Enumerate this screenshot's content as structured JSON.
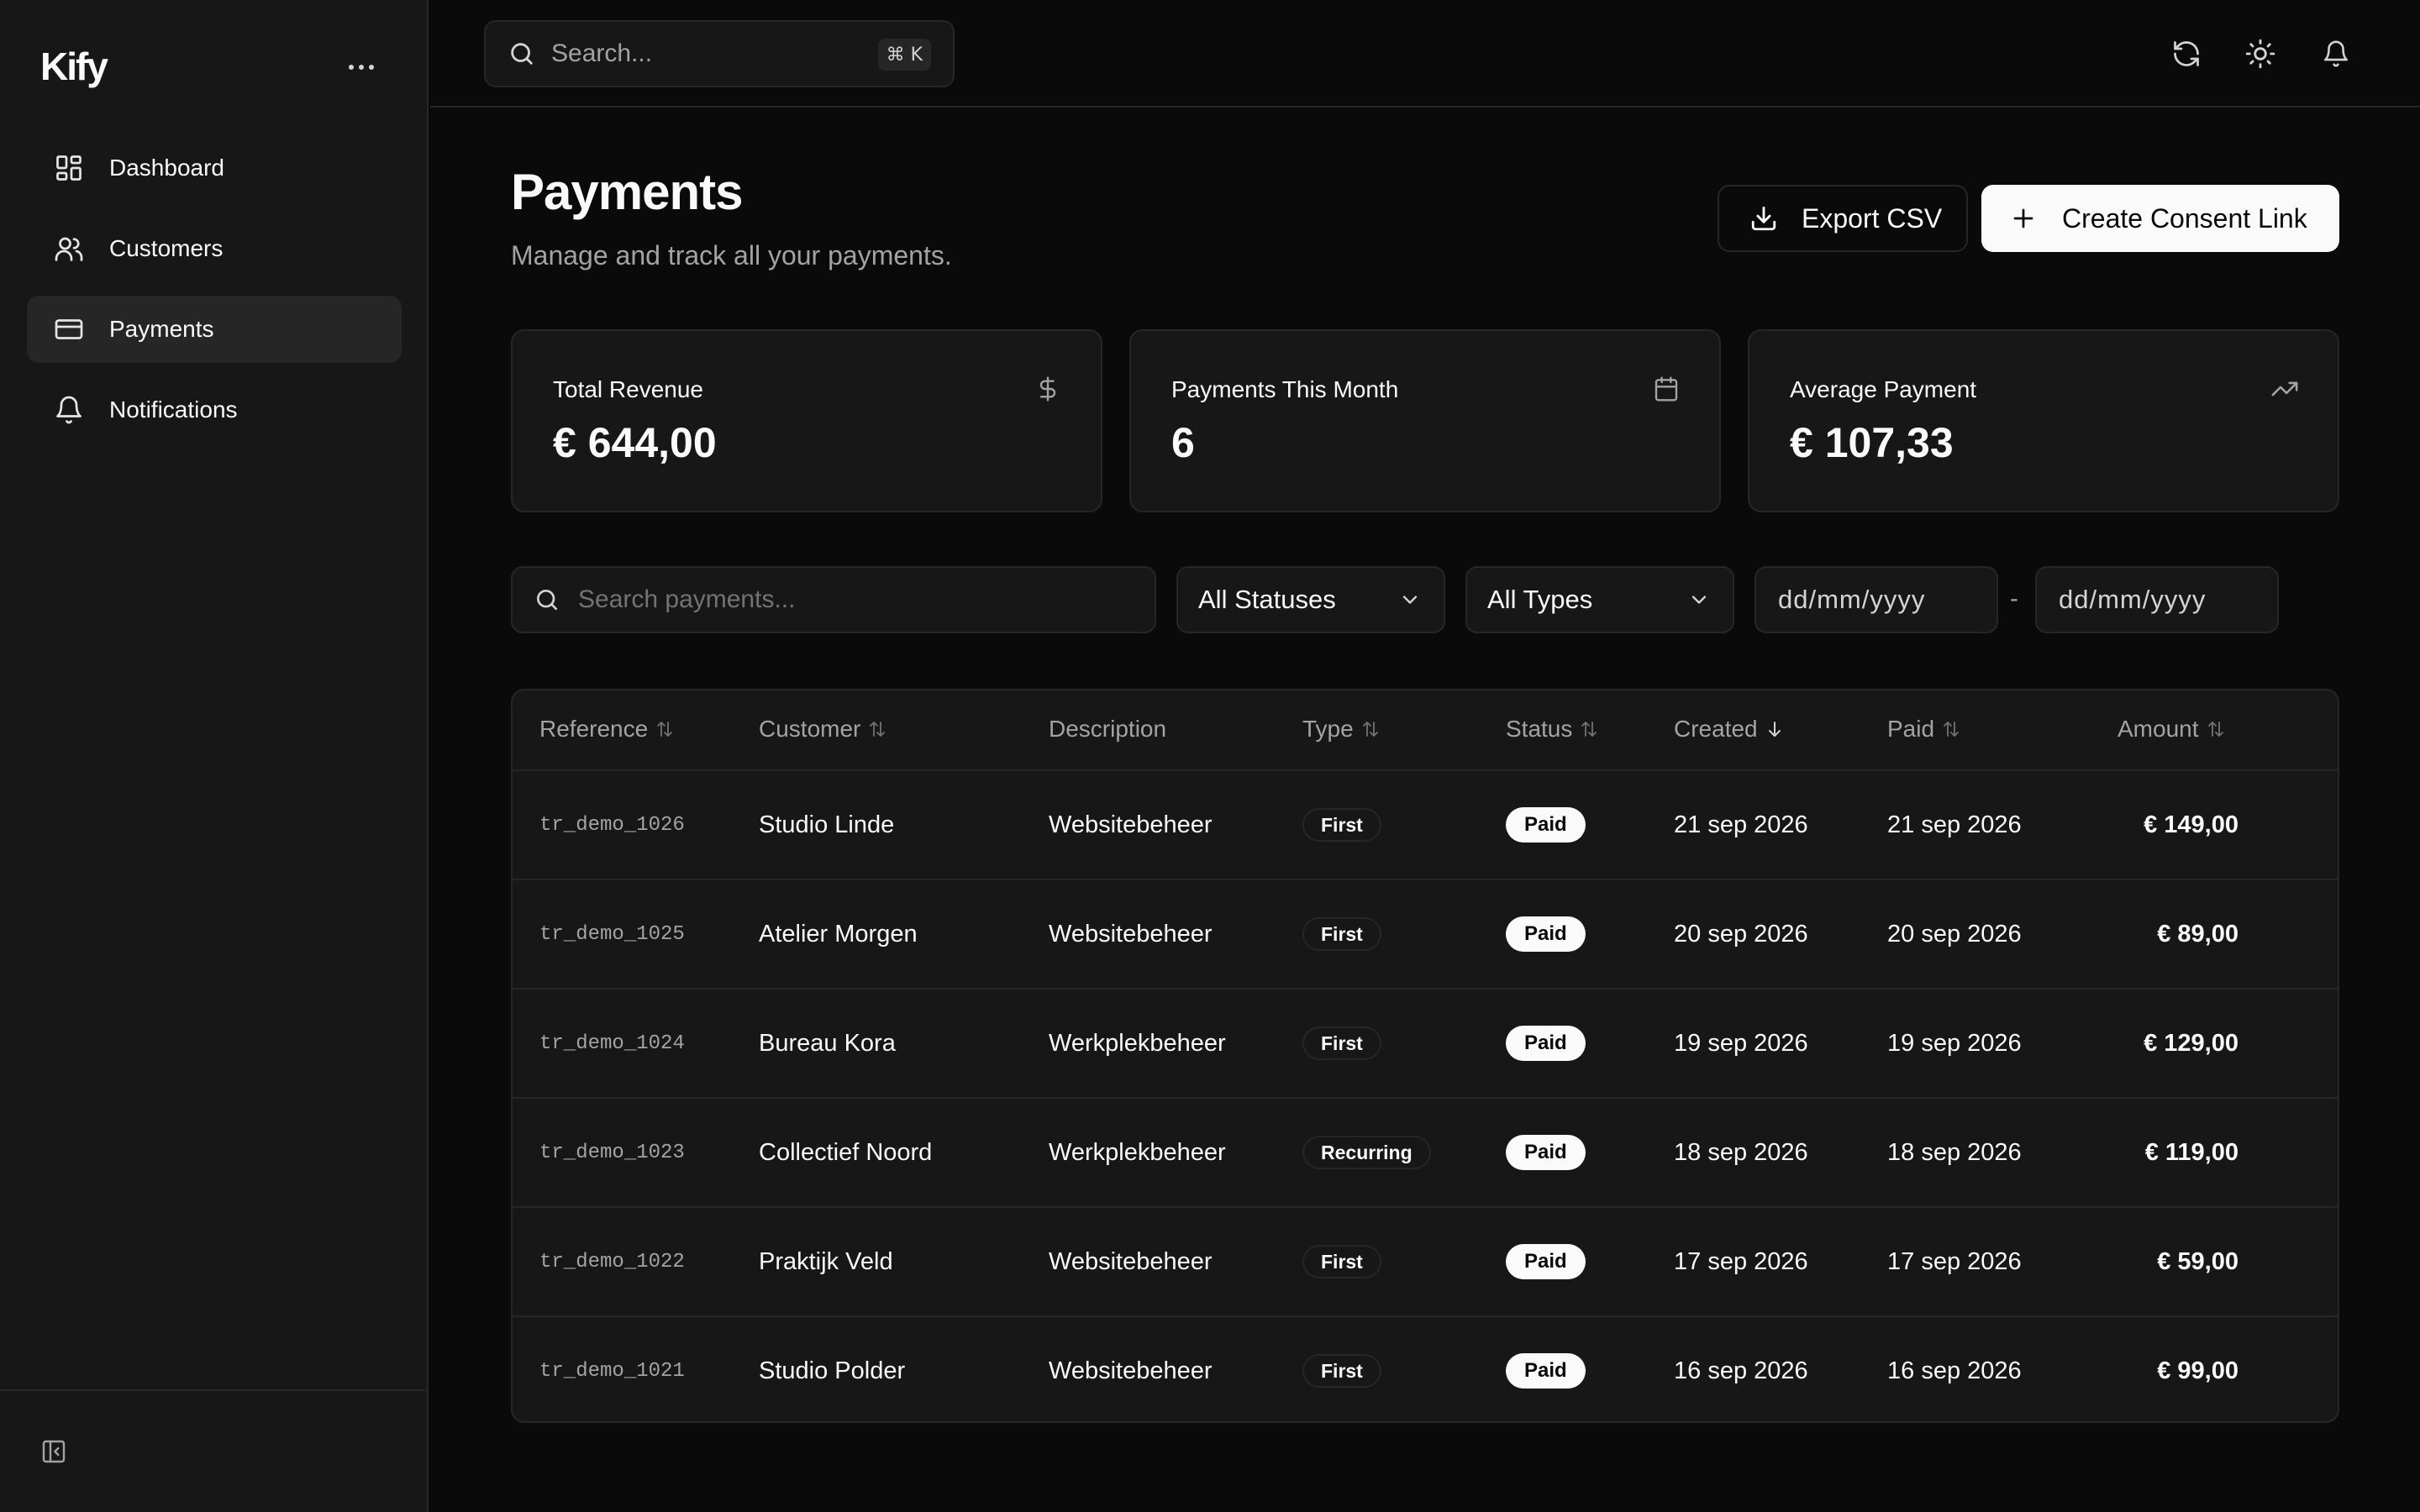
{
  "app": {
    "brand": "Kify"
  },
  "sidebar": {
    "items": [
      {
        "label": "Dashboard",
        "icon": "dashboard-icon",
        "active": false
      },
      {
        "label": "Customers",
        "icon": "users-icon",
        "active": false
      },
      {
        "label": "Payments",
        "icon": "credit-card-icon",
        "active": true
      },
      {
        "label": "Notifications",
        "icon": "bell-icon",
        "active": false
      }
    ]
  },
  "header": {
    "search_placeholder": "Search...",
    "shortcut_cmd": "⌘",
    "shortcut_key": "K"
  },
  "page": {
    "title": "Payments",
    "subtitle": "Manage and track all your payments.",
    "export_label": "Export CSV",
    "create_label": "Create Consent Link"
  },
  "stats": [
    {
      "title": "Total Revenue",
      "value": "€ 644,00",
      "icon": "dollar-icon"
    },
    {
      "title": "Payments This Month",
      "value": "6",
      "icon": "calendar-icon"
    },
    {
      "title": "Average Payment",
      "value": "€ 107,33",
      "icon": "trending-up-icon"
    }
  ],
  "filters": {
    "search_placeholder": "Search payments...",
    "status": "All Statuses",
    "type": "All Types",
    "date_from": "dd/mm/yyyy",
    "date_sep": "-",
    "date_to": "dd/mm/yyyy"
  },
  "table": {
    "columns": {
      "reference": "Reference",
      "customer": "Customer",
      "description": "Description",
      "type": "Type",
      "status": "Status",
      "created": "Created",
      "paid": "Paid",
      "amount": "Amount"
    },
    "rows": [
      {
        "reference": "tr_demo_1026",
        "customer": "Studio Linde",
        "description": "Websitebeheer",
        "type": "First",
        "status": "Paid",
        "created": "21 sep 2026",
        "paid": "21 sep 2026",
        "amount": "€ 149,00"
      },
      {
        "reference": "tr_demo_1025",
        "customer": "Atelier Morgen",
        "description": "Websitebeheer",
        "type": "First",
        "status": "Paid",
        "created": "20 sep 2026",
        "paid": "20 sep 2026",
        "amount": "€ 89,00"
      },
      {
        "reference": "tr_demo_1024",
        "customer": "Bureau Kora",
        "description": "Werkplekbeheer",
        "type": "First",
        "status": "Paid",
        "created": "19 sep 2026",
        "paid": "19 sep 2026",
        "amount": "€ 129,00"
      },
      {
        "reference": "tr_demo_1023",
        "customer": "Collectief Noord",
        "description": "Werkplekbeheer",
        "type": "Recurring",
        "status": "Paid",
        "created": "18 sep 2026",
        "paid": "18 sep 2026",
        "amount": "€ 119,00"
      },
      {
        "reference": "tr_demo_1022",
        "customer": "Praktijk Veld",
        "description": "Websitebeheer",
        "type": "First",
        "status": "Paid",
        "created": "17 sep 2026",
        "paid": "17 sep 2026",
        "amount": "€ 59,00"
      },
      {
        "reference": "tr_demo_1021",
        "customer": "Studio Polder",
        "description": "Websitebeheer",
        "type": "First",
        "status": "Paid",
        "created": "16 sep 2026",
        "paid": "16 sep 2026",
        "amount": "€ 99,00"
      }
    ]
  },
  "colors": {
    "background": "#0a0a0a",
    "surface": "#171717",
    "border": "#262626",
    "text": "#fafafa",
    "muted": "#a3a3a3"
  }
}
